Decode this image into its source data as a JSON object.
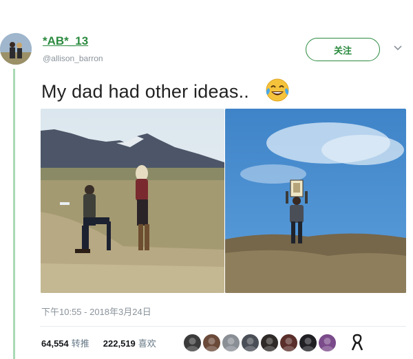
{
  "tweet": {
    "display_name": "*AB*_13",
    "handle": "@allison_barron",
    "follow_label": "关注",
    "text": "My dad had other ideas..",
    "emoji": "face-with-tears-of-joy-icon",
    "timestamp": "下午10:55 - 2018年3月24日",
    "retweets_count": "64,554",
    "retweets_label": "转推",
    "likes_count": "222,519",
    "likes_label": "喜欢"
  },
  "colors": {
    "accent": "#2a8a3e",
    "thread_line": "#a9d9b4",
    "muted": "#8a939b"
  },
  "likers": [
    {
      "name": "liker-avatar-1",
      "color": "#3b3b3b"
    },
    {
      "name": "liker-avatar-2",
      "color": "#6b4a3a"
    },
    {
      "name": "liker-avatar-3",
      "color": "#8a8f96"
    },
    {
      "name": "liker-avatar-4",
      "color": "#4a4f57"
    },
    {
      "name": "liker-avatar-5",
      "color": "#2f2a28"
    },
    {
      "name": "liker-avatar-6",
      "color": "#5a2e2a"
    },
    {
      "name": "liker-avatar-7",
      "color": "#1f1f24"
    },
    {
      "name": "liker-avatar-8",
      "color": "#7a4a8a"
    }
  ]
}
